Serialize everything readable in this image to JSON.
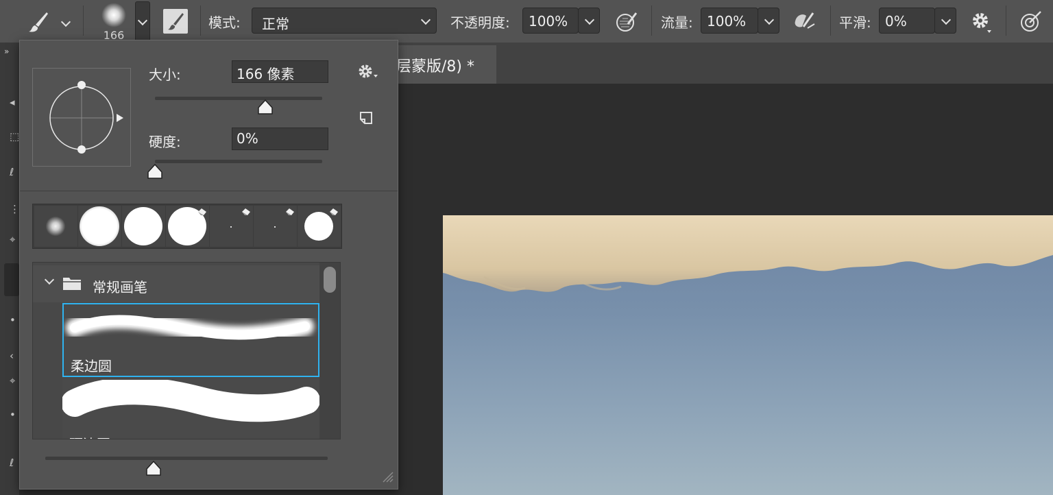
{
  "options_bar": {
    "brush_size": "166",
    "mode_label": "模式:",
    "mode_value": "正常",
    "opacity_label": "不透明度:",
    "opacity_value": "100%",
    "flow_label": "流量:",
    "flow_value": "100%",
    "smoothing_label": "平滑:",
    "smoothing_value": "0%"
  },
  "document": {
    "tab_title": "层蒙版/8) *"
  },
  "brush_panel": {
    "size_label": "大小:",
    "size_value": "166 像素",
    "hardness_label": "硬度:",
    "hardness_value": "0%",
    "size_slider_fraction": 0.66,
    "hardness_slider_fraction": 0.0,
    "folder_name": "常规画笔",
    "brushes": [
      {
        "name": "柔边圆",
        "selected": true
      },
      {
        "name": "硬边圆",
        "selected": false
      }
    ]
  },
  "colors": {
    "selection_accent": "#2fb3f0",
    "panel_bg": "#535353"
  }
}
